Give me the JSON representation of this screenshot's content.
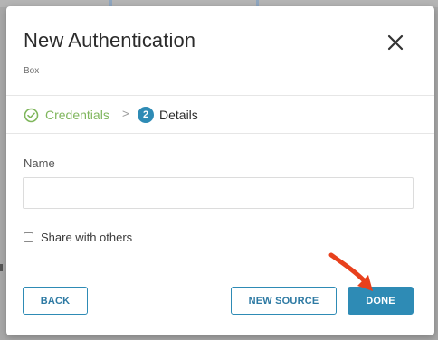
{
  "modal": {
    "title": "New Authentication",
    "subtitle": "Box",
    "close_icon": "close-icon"
  },
  "steps": [
    {
      "label": "Credentials",
      "status": "completed",
      "icon": "check-circle-icon",
      "color": "#7fb65c"
    },
    {
      "number": "2",
      "label": "Details",
      "status": "current",
      "color": "#2e8bb5"
    }
  ],
  "step_separator": ">",
  "form": {
    "name_label": "Name",
    "name_value": "",
    "name_placeholder": "",
    "share_label": "Share with others",
    "share_checked": false
  },
  "buttons": {
    "back": "BACK",
    "new_source": "NEW SOURCE",
    "done": "DONE"
  },
  "colors": {
    "accent": "#2e8bb5",
    "success": "#7fb65c",
    "annotation_arrow": "#e8401c"
  }
}
